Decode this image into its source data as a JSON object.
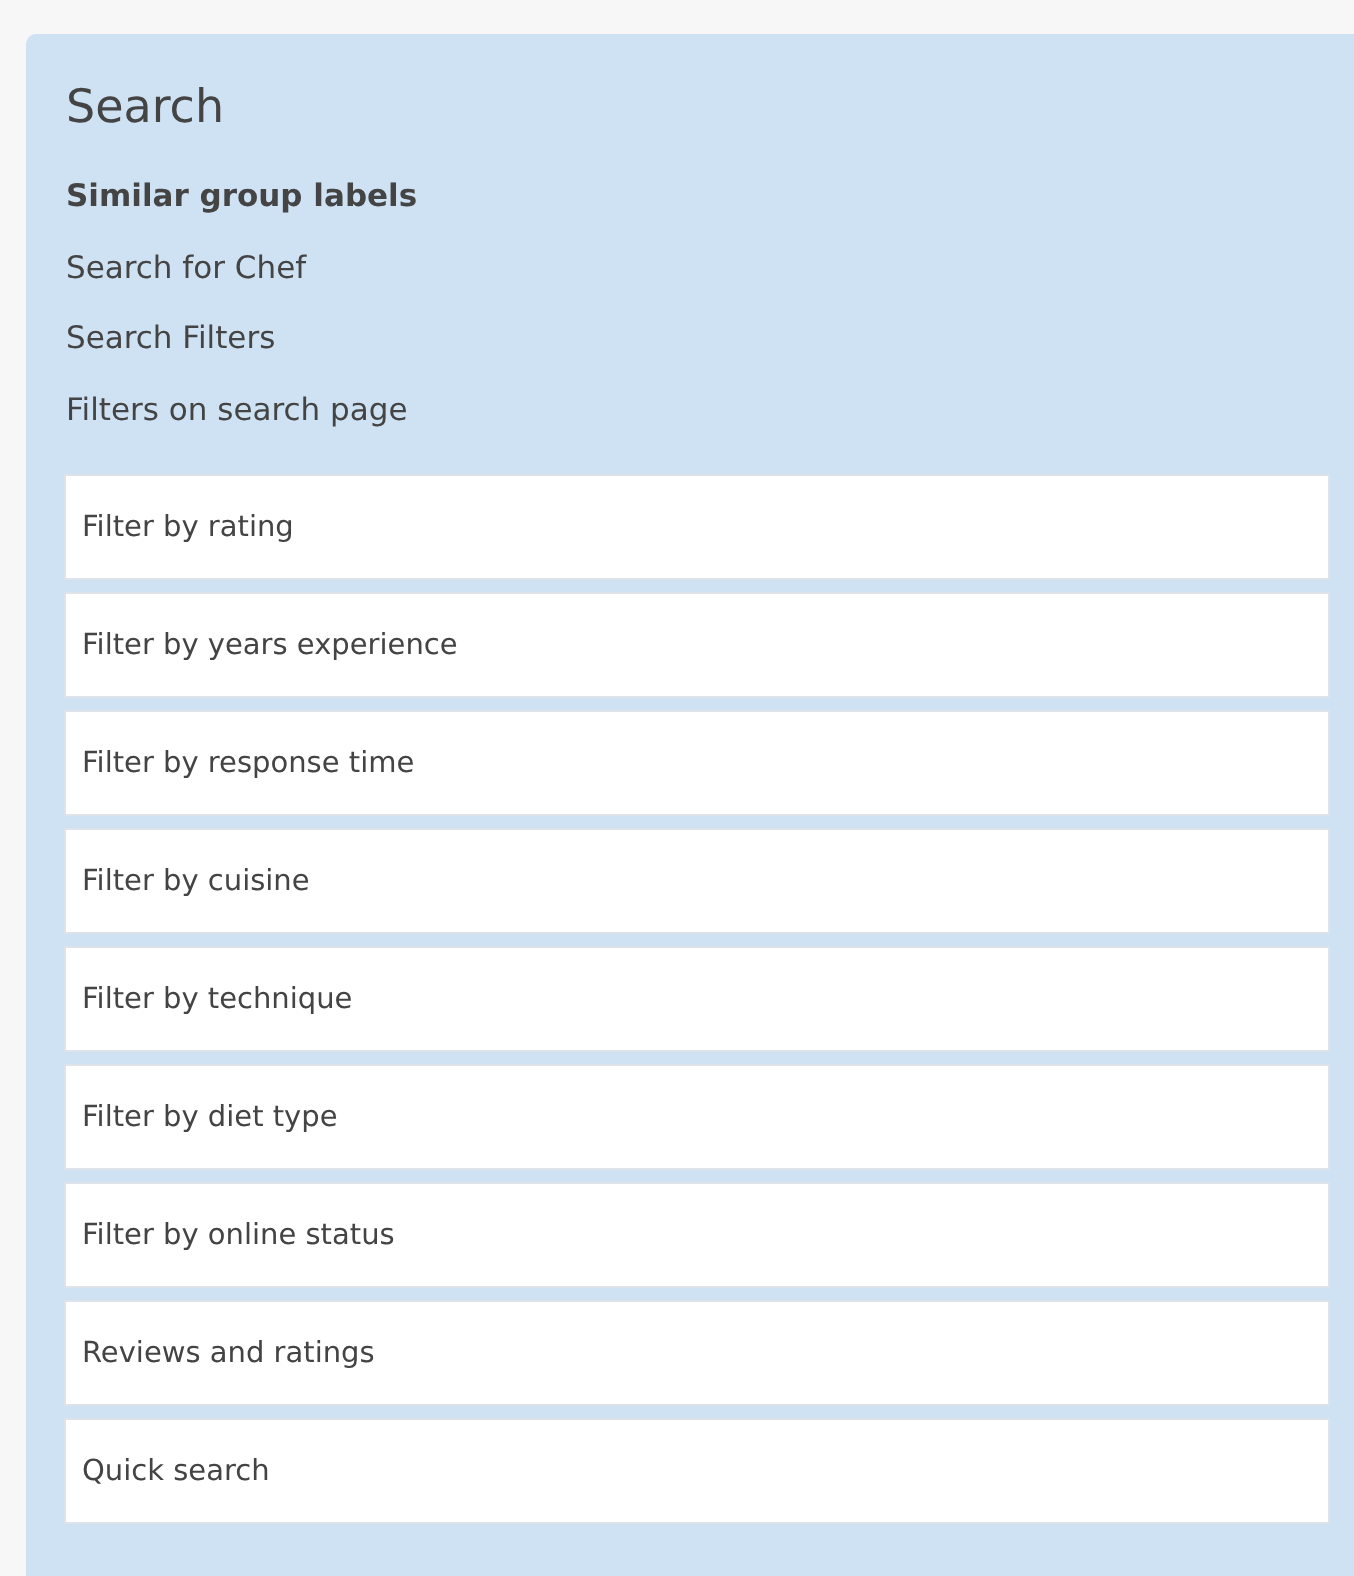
{
  "panel": {
    "title": "Search",
    "links": [
      {
        "label": "Similar group labels",
        "selected": true
      },
      {
        "label": "Search for Chef",
        "selected": false
      },
      {
        "label": "Search Filters",
        "selected": false
      },
      {
        "label": "Filters on search page",
        "selected": false
      }
    ],
    "items": [
      "Filter by rating",
      "Filter by years experience",
      "Filter by response time",
      "Filter by cuisine",
      "Filter by technique",
      "Filter by diet type",
      "Filter by online status",
      "Reviews and ratings",
      "Quick search"
    ]
  }
}
